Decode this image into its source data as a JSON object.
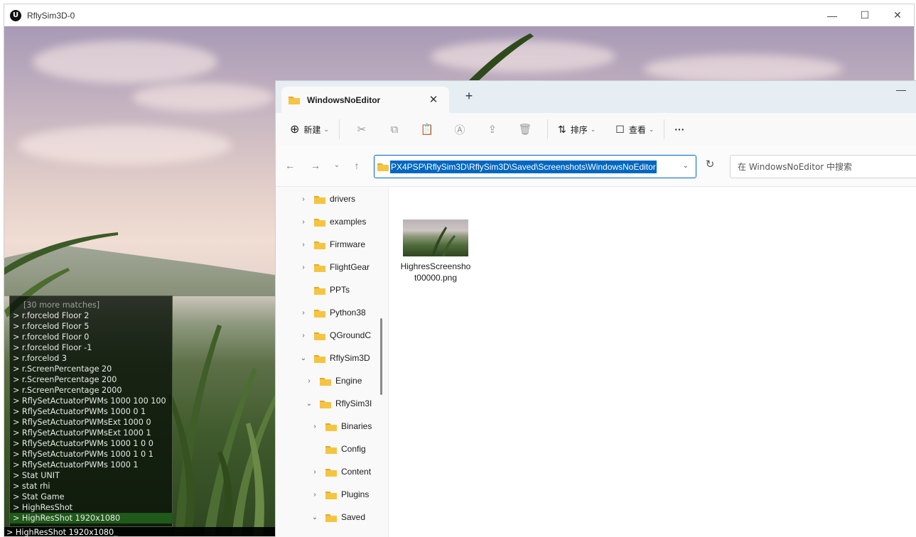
{
  "window": {
    "title": "RflySim3D-0",
    "logo_text": "U",
    "controls": {
      "minimize": "—",
      "maximize": "☐",
      "close": "✕"
    }
  },
  "console": {
    "lines": [
      "[30 more matches]",
      "> r.forcelod Floor 2",
      "> r.forcelod Floor 5",
      "> r.forcelod Floor 0",
      "> r.forcelod Floor -1",
      "> r.forcelod 3",
      "> r.ScreenPercentage 20",
      "> r.ScreenPercentage 200",
      "> r.ScreenPercentage 2000",
      "> RflySetActuatorPWMs 1000 100 100",
      "> RflySetActuatorPWMs 1000 0 1",
      "> RflySetActuatorPWMsExt 1000 0",
      "> RflySetActuatorPWMsExt 1000 1",
      "> RflySetActuatorPWMs 1000 1 0 0",
      "> RflySetActuatorPWMs 1000 1 0 1",
      "> RflySetActuatorPWMs 1000 1",
      "> Stat UNIT",
      "> stat rhi",
      "> Stat Game",
      "> HighResShot",
      "> HighResShot 1920x1080"
    ],
    "selected_index": 20,
    "input": "> HighResShot 1920x1080_"
  },
  "explorer": {
    "tab_title": "WindowsNoEditor",
    "tab_close": "✕",
    "new_tab": "+",
    "minimize": "—",
    "toolbar": {
      "new_icon": "⊕",
      "new_label": "新建",
      "cut_icon": "✂",
      "copy_icon": "⧉",
      "paste_icon": "📋",
      "rename_icon": "Ⓐ",
      "share_icon": "⇪",
      "delete_icon": "🗑",
      "sort_icon": "⇅",
      "sort_label": "排序",
      "view_icon": "☐",
      "view_label": "查看",
      "more_label": "···",
      "chevron": "⌄"
    },
    "nav": {
      "back": "←",
      "forward": "→",
      "recent": "⌄",
      "up": "↑",
      "refresh": "↻"
    },
    "address": "PX4PSP\\RflySim3D\\RflySim3D\\Saved\\Screenshots\\WindowsNoEditor",
    "address_chevron": "⌄",
    "search_placeholder": "在 WindowsNoEditor 中搜索",
    "tree": [
      {
        "label": "drivers",
        "chevron": "›",
        "indent": 0
      },
      {
        "label": "examples",
        "chevron": "›",
        "indent": 0
      },
      {
        "label": "Firmware",
        "chevron": "›",
        "indent": 0
      },
      {
        "label": "FlightGear",
        "chevron": "›",
        "indent": 0
      },
      {
        "label": "PPTs",
        "chevron": "",
        "indent": 0
      },
      {
        "label": "Python38",
        "chevron": "›",
        "indent": 0
      },
      {
        "label": "QGroundC",
        "chevron": "›",
        "indent": 0
      },
      {
        "label": "RflySim3D",
        "chevron": "⌄",
        "indent": 0
      },
      {
        "label": "Engine",
        "chevron": "›",
        "indent": 1
      },
      {
        "label": "RflySim3I",
        "chevron": "⌄",
        "indent": 1
      },
      {
        "label": "Binaries",
        "chevron": "›",
        "indent": 2
      },
      {
        "label": "Config",
        "chevron": "",
        "indent": 2
      },
      {
        "label": "Content",
        "chevron": "›",
        "indent": 2
      },
      {
        "label": "Plugins",
        "chevron": "›",
        "indent": 2
      },
      {
        "label": "Saved",
        "chevron": "⌄",
        "indent": 2
      }
    ],
    "file": {
      "name": "HighresScreenshot00000.png"
    }
  },
  "colors": {
    "accent": "#0067c0",
    "folder_yellow": "#f4c542",
    "folder_dark": "#e2a92b",
    "console_selection": "#1f5a1a"
  }
}
